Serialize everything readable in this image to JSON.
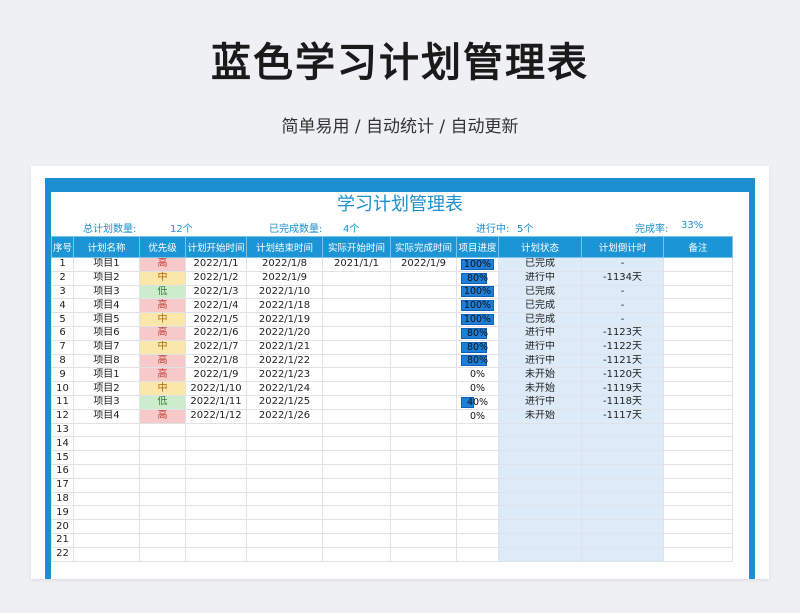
{
  "page": {
    "title": "蓝色学习计划管理表",
    "subtitle": "简单易用 / 自动统计 / 自动更新"
  },
  "sheet": {
    "title": "学习计划管理表",
    "stats": {
      "total_label": "总计划数量:",
      "total_value": "12个",
      "done_label": "已完成数量:",
      "done_value": "4个",
      "doing_label": "进行中:",
      "doing_value": "5个",
      "rate_label": "完成率:",
      "rate_value": "33%"
    },
    "headers": [
      "序号",
      "计划名称",
      "优先级",
      "计划开始时间",
      "计划结束时间",
      "实际开始时间",
      "实际完成时间",
      "项目进度",
      "计划状态",
      "计划倒计时",
      "备注"
    ],
    "rows": [
      {
        "no": "1",
        "name": "项目1",
        "priority": "高",
        "plan_start": "2022/1/1",
        "plan_end": "2022/1/8",
        "act_start": "2021/1/1",
        "act_end": "2022/1/9",
        "progress": "100%",
        "progress_value": 1.0,
        "status": "已完成",
        "countdown": "-",
        "note": ""
      },
      {
        "no": "2",
        "name": "项目2",
        "priority": "中",
        "plan_start": "2022/1/2",
        "plan_end": "2022/1/9",
        "act_start": "",
        "act_end": "",
        "progress": "80%",
        "progress_value": 0.8,
        "status": "进行中",
        "countdown": "-1134天",
        "note": ""
      },
      {
        "no": "3",
        "name": "项目3",
        "priority": "低",
        "plan_start": "2022/1/3",
        "plan_end": "2022/1/10",
        "act_start": "",
        "act_end": "",
        "progress": "100%",
        "progress_value": 1.0,
        "status": "已完成",
        "countdown": "-",
        "note": ""
      },
      {
        "no": "4",
        "name": "项目4",
        "priority": "高",
        "plan_start": "2022/1/4",
        "plan_end": "2022/1/18",
        "act_start": "",
        "act_end": "",
        "progress": "100%",
        "progress_value": 1.0,
        "status": "已完成",
        "countdown": "-",
        "note": ""
      },
      {
        "no": "5",
        "name": "项目5",
        "priority": "中",
        "plan_start": "2022/1/5",
        "plan_end": "2022/1/19",
        "act_start": "",
        "act_end": "",
        "progress": "100%",
        "progress_value": 1.0,
        "status": "已完成",
        "countdown": "-",
        "note": ""
      },
      {
        "no": "6",
        "name": "项目6",
        "priority": "高",
        "plan_start": "2022/1/6",
        "plan_end": "2022/1/20",
        "act_start": "",
        "act_end": "",
        "progress": "80%",
        "progress_value": 0.8,
        "status": "进行中",
        "countdown": "-1123天",
        "note": ""
      },
      {
        "no": "7",
        "name": "项目7",
        "priority": "中",
        "plan_start": "2022/1/7",
        "plan_end": "2022/1/21",
        "act_start": "",
        "act_end": "",
        "progress": "80%",
        "progress_value": 0.8,
        "status": "进行中",
        "countdown": "-1122天",
        "note": ""
      },
      {
        "no": "8",
        "name": "项目8",
        "priority": "高",
        "plan_start": "2022/1/8",
        "plan_end": "2022/1/22",
        "act_start": "",
        "act_end": "",
        "progress": "80%",
        "progress_value": 0.8,
        "status": "进行中",
        "countdown": "-1121天",
        "note": ""
      },
      {
        "no": "9",
        "name": "项目1",
        "priority": "高",
        "plan_start": "2022/1/9",
        "plan_end": "2022/1/23",
        "act_start": "",
        "act_end": "",
        "progress": "0%",
        "progress_value": 0,
        "status": "未开始",
        "countdown": "-1120天",
        "note": ""
      },
      {
        "no": "10",
        "name": "项目2",
        "priority": "中",
        "plan_start": "2022/1/10",
        "plan_end": "2022/1/24",
        "act_start": "",
        "act_end": "",
        "progress": "0%",
        "progress_value": 0,
        "status": "未开始",
        "countdown": "-1119天",
        "note": ""
      },
      {
        "no": "11",
        "name": "项目3",
        "priority": "低",
        "plan_start": "2022/1/11",
        "plan_end": "2022/1/25",
        "act_start": "",
        "act_end": "",
        "progress": "40%",
        "progress_value": 0.4,
        "status": "进行中",
        "countdown": "-1118天",
        "note": ""
      },
      {
        "no": "12",
        "name": "项目4",
        "priority": "高",
        "plan_start": "2022/1/12",
        "plan_end": "2022/1/26",
        "act_start": "",
        "act_end": "",
        "progress": "0%",
        "progress_value": 0,
        "status": "未开始",
        "countdown": "-1117天",
        "note": ""
      },
      {
        "no": "13"
      },
      {
        "no": "14"
      },
      {
        "no": "15"
      },
      {
        "no": "16"
      },
      {
        "no": "17"
      },
      {
        "no": "18"
      },
      {
        "no": "19"
      },
      {
        "no": "20"
      },
      {
        "no": "21"
      },
      {
        "no": "22"
      }
    ]
  },
  "colors": {
    "accent": "#1b8fcf",
    "header_bg": "#1b95d6",
    "status_bg": "#dcebf7",
    "priority_high_bg": "#f7c9c9",
    "priority_mid_bg": "#fbe7a9",
    "priority_low_bg": "#cdeccb",
    "progress_bar": "#1f7fd6"
  }
}
